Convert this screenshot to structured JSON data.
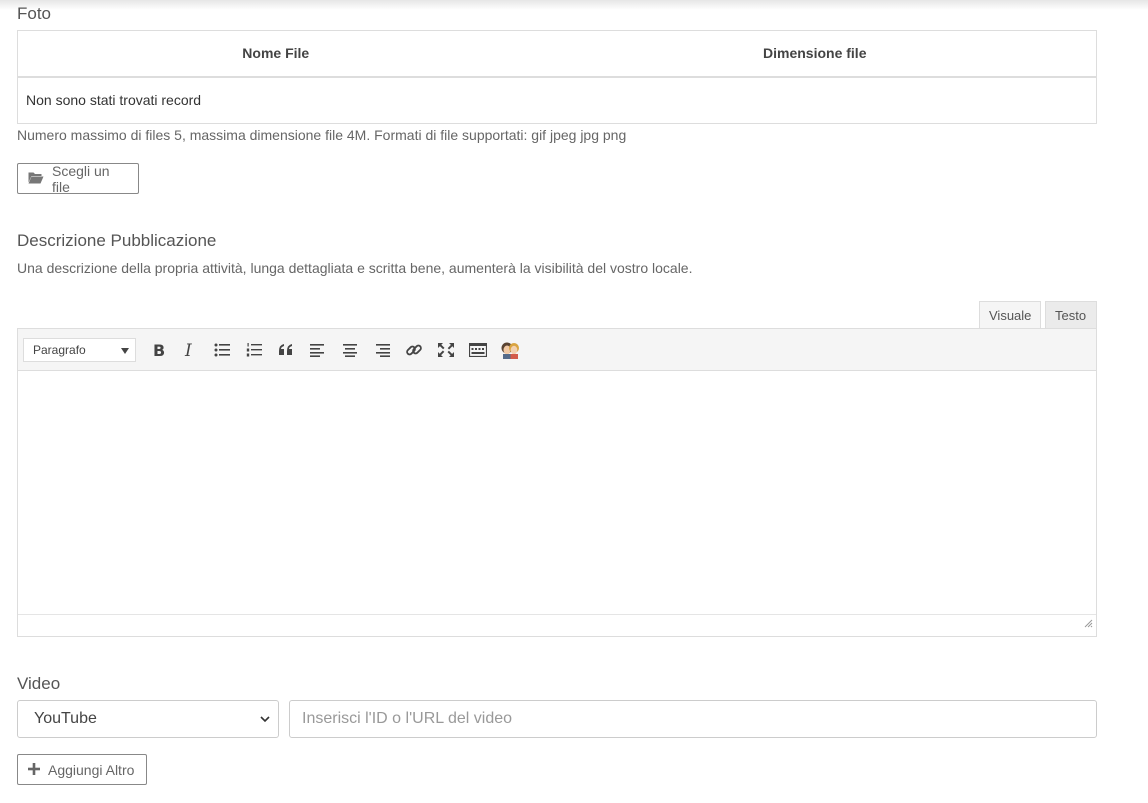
{
  "foto": {
    "title": "Foto",
    "columns": [
      "Nome File",
      "Dimensione file"
    ],
    "empty_text": "Non sono stati trovati record",
    "help": "Numero massimo di files 5, massima dimensione file 4M. Formati di file supportati: gif jpeg jpg png",
    "choose_button": "Scegli un file",
    "choose_icon": "folder-open-icon"
  },
  "description": {
    "title": "Descrizione Pubblicazione",
    "help": "Una descrizione della propria attività, lunga dettagliata e scritta bene, aumenterà la visibilità del vostro locale.",
    "tabs": {
      "visual": "Visuale",
      "text": "Testo"
    },
    "format_select": "Paragrafo",
    "toolbar_icons": [
      "bold-icon",
      "italic-icon",
      "bullet-list-icon",
      "numbered-list-icon",
      "blockquote-icon",
      "align-left-icon",
      "align-center-icon",
      "align-right-icon",
      "link-icon",
      "fullscreen-icon",
      "toolbar-toggle-icon",
      "avatar-faces-icon"
    ],
    "content": ""
  },
  "video": {
    "title": "Video",
    "provider": "YouTube",
    "input_placeholder": "Inserisci l'ID o l'URL del video",
    "add_button": "Aggiungi Altro",
    "add_icon": "plus-icon"
  },
  "colors": {
    "border": "#dddddd",
    "text": "#555555",
    "toolbar_bg": "#f5f5f5"
  }
}
